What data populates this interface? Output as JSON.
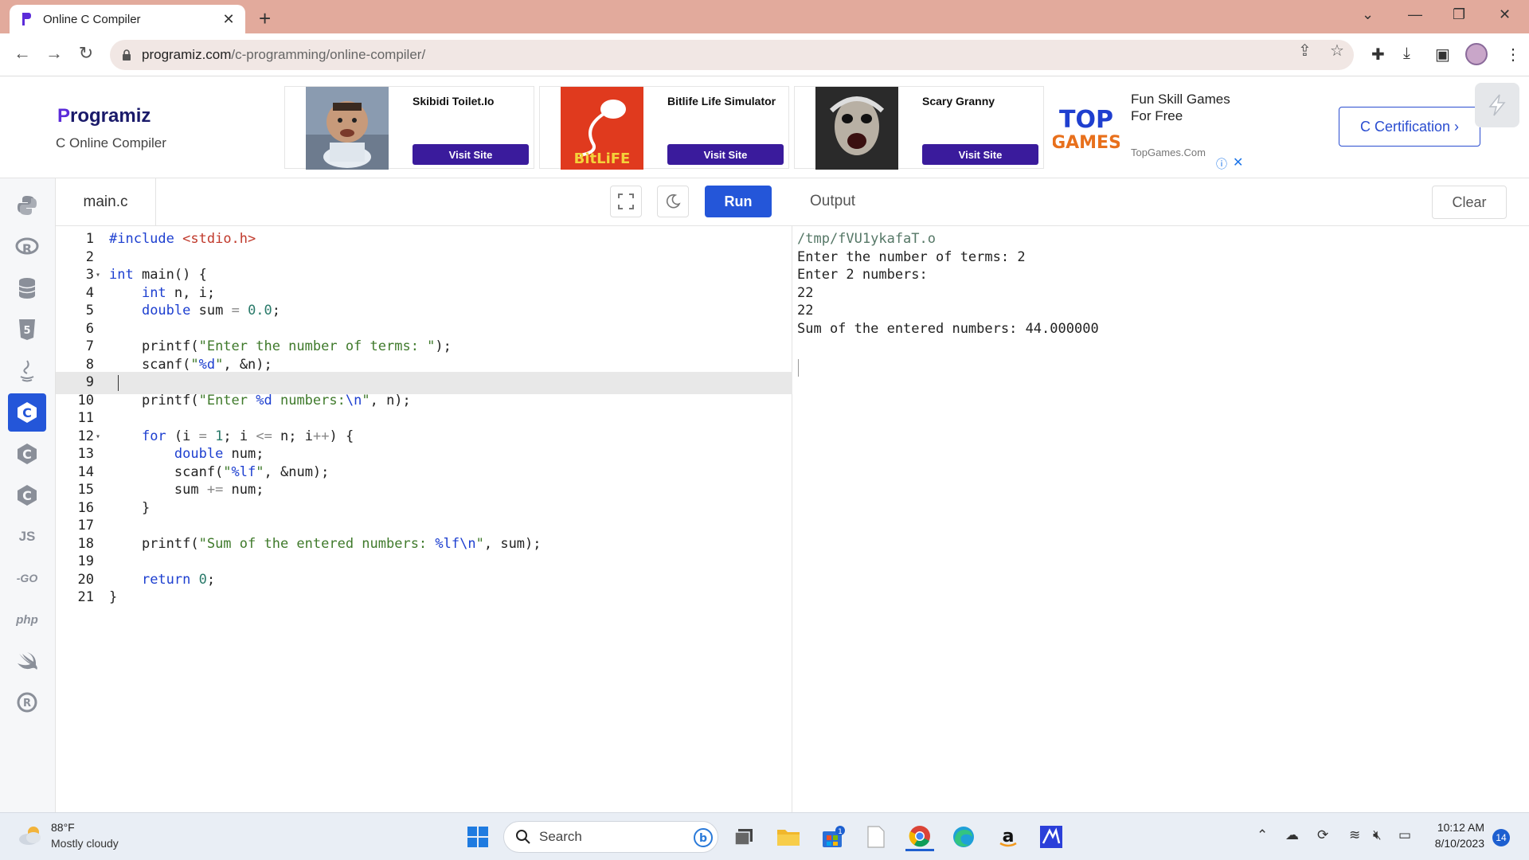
{
  "browser": {
    "tab_title": "Online C Compiler",
    "url_host": "programiz.com",
    "url_path": "/c-programming/online-compiler/"
  },
  "site": {
    "logo": "rogramiz",
    "logo_p": "P",
    "subtitle": "C Online Compiler",
    "certification_button": "C Certification ›"
  },
  "ads": [
    {
      "title": "Skibidi Toilet.Io",
      "button": "Visit Site"
    },
    {
      "title": "Bitlife Life Simulator",
      "button": "Visit Site",
      "image_text": "BitLiFE"
    },
    {
      "title": "Scary Granny",
      "button": "Visit Site"
    }
  ],
  "topgames": {
    "logo_line1": "TOP",
    "logo_line2": "GAMES",
    "title": "Fun Skill Games For Free",
    "url": "TopGames.Com"
  },
  "sidebar": {
    "languages": [
      "python",
      "r",
      "sql",
      "html",
      "java",
      "c",
      "cpp",
      "csharp",
      "JS",
      "GO",
      "php",
      "swift",
      "rust"
    ],
    "active": "c",
    "js_label": "JS",
    "go_label": "-GO",
    "php_label": "php"
  },
  "editor": {
    "filename": "main.c",
    "run_label": "Run",
    "highlighted_line": 9,
    "lines": [
      "#include <stdio.h>",
      "",
      "int main() {",
      "    int n, i;",
      "    double sum = 0.0;",
      "",
      "    printf(\"Enter the number of terms: \");",
      "    scanf(\"%d\", &n);",
      "",
      "    printf(\"Enter %d numbers:\\n\", n);",
      "",
      "    for (i = 1; i <= n; i++) {",
      "        double num;",
      "        scanf(\"%lf\", &num);",
      "        sum += num;",
      "    }",
      "",
      "    printf(\"Sum of the entered numbers: %lf\\n\", sum);",
      "",
      "    return 0;",
      "}"
    ]
  },
  "output": {
    "title": "Output",
    "clear_label": "Clear",
    "lines": [
      "/tmp/fVU1ykafaT.o",
      "Enter the number of terms: 2",
      "Enter 2 numbers:",
      "22",
      "22",
      "Sum of the entered numbers: 44.000000"
    ]
  },
  "taskbar": {
    "weather_temp": "88°F",
    "weather_desc": "Mostly cloudy",
    "search_label": "Search",
    "time": "10:12 AM",
    "date": "8/10/2023",
    "notification_count": "14",
    "store_badge": "1"
  },
  "colors": {
    "accent": "#2456d9",
    "tabbar": "#e2aa9c",
    "ad_button": "#3a1b9c"
  }
}
